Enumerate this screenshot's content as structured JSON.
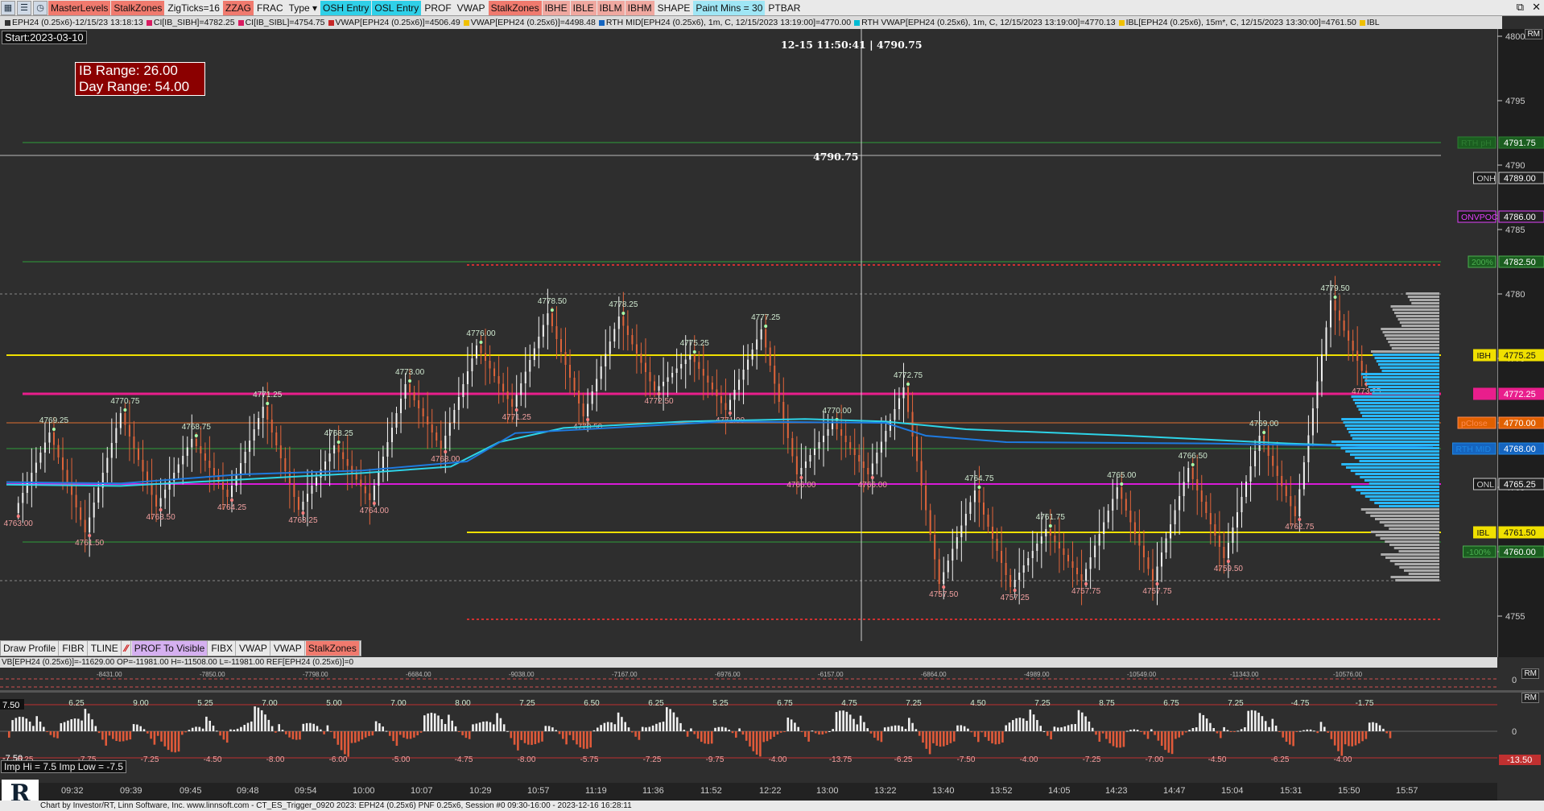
{
  "toolbar": {
    "buttons": [
      {
        "label": "MasterLevels",
        "style": "red"
      },
      {
        "label": "StalkZones",
        "style": "red"
      },
      {
        "label": "ZigTicks=16",
        "style": "grey"
      },
      {
        "label": "ZZAG",
        "style": "red"
      },
      {
        "label": "FRAC",
        "style": "grey"
      },
      {
        "label": "Type",
        "style": "grey"
      },
      {
        "label": "OSH Entry",
        "style": "blue"
      },
      {
        "label": "OSL Entry",
        "style": "blue"
      },
      {
        "label": "PROF",
        "style": "grey"
      },
      {
        "label": "VWAP",
        "style": "grey"
      },
      {
        "label": "StalkZones",
        "style": "red"
      },
      {
        "label": "IBHE",
        "style": "pink"
      },
      {
        "label": "IBLE",
        "style": "pink"
      },
      {
        "label": "IBLM",
        "style": "pink"
      },
      {
        "label": "IBHM",
        "style": "pink"
      },
      {
        "label": "SHAPE",
        "style": "grey"
      },
      {
        "label": "Paint Mins = 30",
        "style": "lblue"
      },
      {
        "label": "PTBAR",
        "style": "grey"
      }
    ],
    "window_controls": [
      "⧉",
      "✕"
    ]
  },
  "legend": [
    {
      "text": "EPH24 (0.25x6)-12/15/23 13:18:13",
      "color": "#333333"
    },
    {
      "text": "CI[IB_SIBH]=4782.25",
      "color": "#d81b60"
    },
    {
      "text": "CI[IB_SIBL]=4754.75",
      "color": "#d81b60"
    },
    {
      "text": "VWAP[EPH24 (0.25x6)]=4506.49",
      "color": "#c62828"
    },
    {
      "text": "VWAP[EPH24 (0.25x6)]=4498.48",
      "color": "#f0c000"
    },
    {
      "text": "RTH MID[EPH24 (0.25x6), 1m, C, 12/15/2023 13:19:00]=4770.00",
      "color": "#1565c0"
    },
    {
      "text": "RTH VWAP[EPH24 (0.25x6), 1m, C, 12/15/2023 13:19:00]=4770.13",
      "color": "#00bcd4"
    },
    {
      "text": "IBL[EPH24 (0.25x6), 15m*, C, 12/15/2023 13:30:00]=4761.50",
      "color": "#f0c000"
    },
    {
      "text": "IBL",
      "color": "#f0c000"
    }
  ],
  "chart": {
    "start_label": "Start:2023-03-10",
    "ib_range": "IB Range: 26.00",
    "day_range": "Day Range: 54.00",
    "crosshair_time": "12-15 11:50:41",
    "crosshair_price": "4790.75",
    "price_line_label": "4790.75",
    "price_ticks": [
      "4800",
      "4795",
      "4790",
      "4785",
      "4780",
      "4775",
      "4770",
      "4765",
      "4760",
      "4755"
    ],
    "level_labels": [
      {
        "name": "RTH pH",
        "price": "4791.75",
        "color": "#2e7d32",
        "tag_bg": "#1b5e20"
      },
      {
        "name": "ONH",
        "price": "4789.00",
        "color": "#cccccc",
        "tag_bg": "#222222"
      },
      {
        "name": "ONVPOC",
        "price": "4786.00",
        "color": "#e040fb",
        "tag_bg": "#222222"
      },
      {
        "name": "200%",
        "price": "4782.50",
        "color": "#4caf50",
        "tag_bg": "#1b5e20"
      },
      {
        "name": "IBH",
        "price": "4775.25",
        "color": "#f0e000",
        "tag_bg": "#f0e000"
      },
      {
        "name": "50%",
        "price": "4772.25",
        "color": "#e91e8c",
        "tag_bg": "#e91e8c"
      },
      {
        "name": "pClose",
        "price": "4770.00",
        "color": "#ff8a50",
        "tag_bg": "#e06000"
      },
      {
        "name": "RTH MID",
        "price": "4768.00",
        "color": "#1e88e5",
        "tag_bg": "#1565c0"
      },
      {
        "name": "ONL",
        "price": "4765.25",
        "color": "#cccccc",
        "tag_bg": "#222222"
      },
      {
        "name": "IBL",
        "price": "4761.50",
        "color": "#f0e000",
        "tag_bg": "#f0e000"
      },
      {
        "name": "-100%",
        "price": "4760.00",
        "color": "#4caf50",
        "tag_bg": "#1b5e20"
      }
    ],
    "rm_label": "RM",
    "swing_labels": [
      {
        "text": "4763.00",
        "type": "low"
      },
      {
        "text": "4769.25",
        "type": "high"
      },
      {
        "text": "4761.50",
        "type": "low"
      },
      {
        "text": "4770.75",
        "type": "high"
      },
      {
        "text": "4763.50",
        "type": "low"
      },
      {
        "text": "4768.75",
        "type": "high"
      },
      {
        "text": "4764.25",
        "type": "low"
      },
      {
        "text": "4771.25",
        "type": "high"
      },
      {
        "text": "4763.25",
        "type": "low"
      },
      {
        "text": "4768.25",
        "type": "high"
      },
      {
        "text": "4764.00",
        "type": "low"
      },
      {
        "text": "4773.00",
        "type": "high"
      },
      {
        "text": "4768.00",
        "type": "low"
      },
      {
        "text": "4776.00",
        "type": "high"
      },
      {
        "text": "4771.25",
        "type": "low"
      },
      {
        "text": "4778.50",
        "type": "high"
      },
      {
        "text": "4770.50",
        "type": "low"
      },
      {
        "text": "4778.25",
        "type": "high"
      },
      {
        "text": "4772.50",
        "type": "low"
      },
      {
        "text": "4775.25",
        "type": "high"
      },
      {
        "text": "4771.00",
        "type": "low"
      },
      {
        "text": "4777.25",
        "type": "high"
      },
      {
        "text": "4766.00",
        "type": "low"
      },
      {
        "text": "4770.00",
        "type": "high"
      },
      {
        "text": "4766.00",
        "type": "low"
      },
      {
        "text": "4772.75",
        "type": "high"
      },
      {
        "text": "4757.50",
        "type": "low"
      },
      {
        "text": "4764.75",
        "type": "high"
      },
      {
        "text": "4757.25",
        "type": "low"
      },
      {
        "text": "4761.75",
        "type": "high"
      },
      {
        "text": "4757.75",
        "type": "low"
      },
      {
        "text": "4765.00",
        "type": "high"
      },
      {
        "text": "4757.75",
        "type": "low"
      },
      {
        "text": "4766.50",
        "type": "high"
      },
      {
        "text": "4759.50",
        "type": "low"
      },
      {
        "text": "4769.00",
        "type": "high"
      },
      {
        "text": "4762.75",
        "type": "low"
      },
      {
        "text": "4779.50",
        "type": "high"
      },
      {
        "text": "4773.25",
        "type": "low"
      }
    ]
  },
  "draw_toolbar": [
    "Draw Profile",
    "FIBR",
    "TLINE",
    "⁄⁄",
    "PROF To Visible",
    "FIBX",
    "VWAP",
    "VWAP",
    "StalkZones"
  ],
  "vb_legend": "VB[EPH24 (0.25x6)]=-11629.00 OP=-11981.00 H=-11508.00 L=-11981.00  REF[EPH24 (0.25x6)]=0",
  "vb_panel": {
    "zero_label": "0",
    "rm_label": "RM",
    "values": [
      "-8431.00",
      "-7850.00",
      "-7798.00",
      "-6684.00",
      "-9038.00",
      "-7167.00",
      "-6976.00",
      "-6157.00",
      "-6864.00",
      "-4989.00",
      "-10549.00",
      "-11343.00",
      "-10576.00"
    ]
  },
  "imp_panel": {
    "rm_label": "RM",
    "zero_label": "0",
    "right_value": "-13.50",
    "hi_line_label": "7.50",
    "lo_line_label": "-7.50",
    "imp_text": "Imp Hi = 7.5  Imp Low = -7.5",
    "pos_labels": [
      "6.25",
      "9.00",
      "5.25",
      "7.00",
      "5.00",
      "7.00",
      "8.00",
      "7.25",
      "6.50",
      "6.25",
      "5.25",
      "6.75",
      "4.75",
      "7.25",
      "4.50",
      "7.25",
      "8.75",
      "6.75",
      "7.25",
      "-4.75",
      "-1.75"
    ],
    "neg_labels": [
      "-5.25",
      "-7.75",
      "-7.25",
      "-4.50",
      "-8.00",
      "-6.00",
      "-5.00",
      "-4.75",
      "-8.00",
      "-5.75",
      "-7.25",
      "-9.75",
      "-4.00",
      "-13.75",
      "-6.25",
      "-7.50",
      "-4.00",
      "-7.25",
      "-7.00",
      "-4.50",
      "-6.25",
      "-4.00"
    ]
  },
  "time_axis": [
    "09:32",
    "09:39",
    "09:45",
    "09:48",
    "09:54",
    "10:00",
    "10:07",
    "10:29",
    "10:57",
    "11:19",
    "11:36",
    "11:52",
    "12:22",
    "13:00",
    "13:22",
    "13:40",
    "13:52",
    "14:05",
    "14:23",
    "14:47",
    "15:04",
    "15:31",
    "15:50",
    "15:57"
  ],
  "footer": "Chart by Investor/RT, Linn Software, Inc. www.linnsoft.com - CT_ES_Trigger_0920 2023: EPH24 (0.25x6) PNF 0.25x6, Session #0 09:30-16:00 - 2023-12-16 16:28:11",
  "logo_text": "R"
}
